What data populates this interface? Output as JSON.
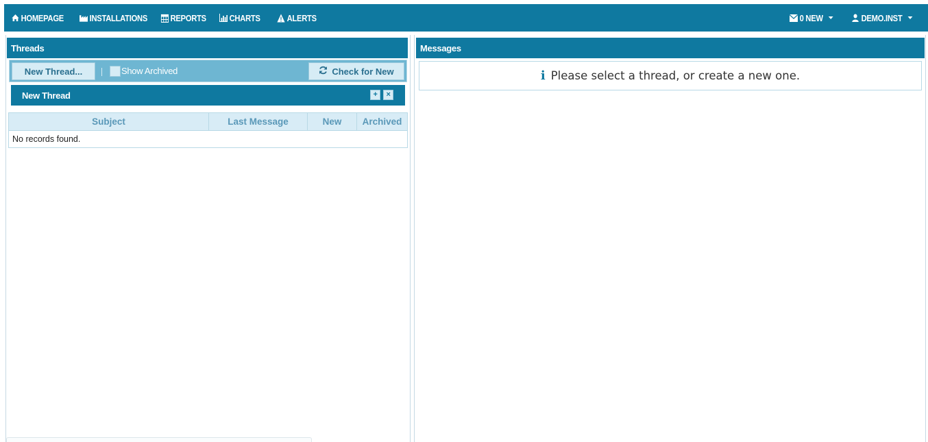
{
  "nav": {
    "homepage": "HOMEPAGE",
    "installations": "INSTALLATIONS",
    "reports": "REPORTS",
    "charts": "CHARTS",
    "alerts": "ALERTS",
    "messages_new": "0 NEW",
    "user": "DEMO.INST"
  },
  "threads_panel": {
    "title": "Threads",
    "new_thread_button": "New Thread...",
    "show_archived_label": "Show Archived",
    "check_for_new_button": "Check for New",
    "new_thread_bar": "New Thread",
    "columns": [
      "Subject",
      "Last Message",
      "New",
      "Archived"
    ],
    "empty_message": "No records found."
  },
  "messages_panel": {
    "title": "Messages",
    "info_text": "Please select a thread, or create a new one."
  },
  "colors": {
    "primary": "#0f79a0",
    "toolbar": "#6eb6d2",
    "header_row": "#d8ecf6"
  }
}
